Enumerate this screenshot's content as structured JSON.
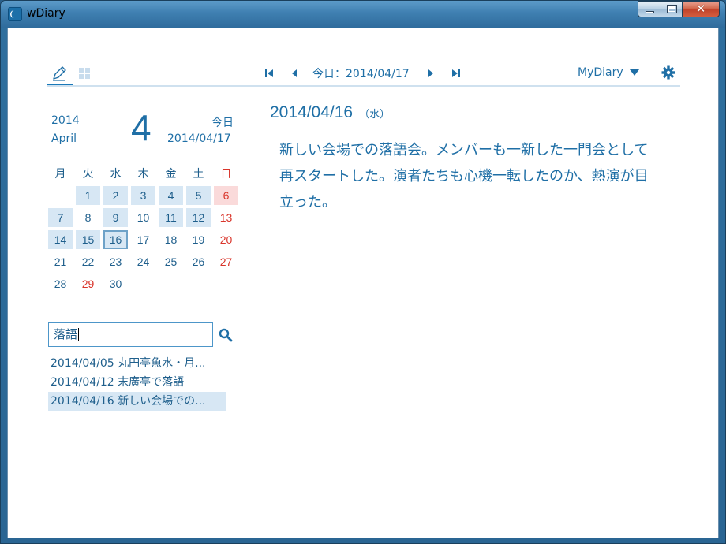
{
  "window": {
    "title": "wDiary",
    "close_symbol": "✕"
  },
  "toolbar": {
    "today_label": "今日：2014/04/17",
    "diary_name": "MyDiary"
  },
  "calendar": {
    "year": "2014",
    "month_name": "April",
    "month_number": "4",
    "today_label": "今日",
    "today_date": "2014/04/17",
    "weekdays": [
      "月",
      "火",
      "水",
      "木",
      "金",
      "土",
      "日"
    ],
    "weeks": [
      [
        {
          "d": ""
        },
        {
          "d": "1",
          "has": true
        },
        {
          "d": "2",
          "has": true
        },
        {
          "d": "3",
          "has": true
        },
        {
          "d": "4",
          "has": true
        },
        {
          "d": "5",
          "has": true
        },
        {
          "d": "6",
          "has": true
        }
      ],
      [
        {
          "d": "7",
          "has": true
        },
        {
          "d": "8"
        },
        {
          "d": "9",
          "has": true
        },
        {
          "d": "10"
        },
        {
          "d": "11",
          "has": true
        },
        {
          "d": "12",
          "has": true
        },
        {
          "d": "13"
        }
      ],
      [
        {
          "d": "14",
          "has": true
        },
        {
          "d": "15",
          "has": true
        },
        {
          "d": "16",
          "has": true,
          "selected": true
        },
        {
          "d": "17"
        },
        {
          "d": "18"
        },
        {
          "d": "19"
        },
        {
          "d": "20"
        }
      ],
      [
        {
          "d": "21"
        },
        {
          "d": "22"
        },
        {
          "d": "23"
        },
        {
          "d": "24"
        },
        {
          "d": "25"
        },
        {
          "d": "26"
        },
        {
          "d": "27"
        }
      ],
      [
        {
          "d": "28"
        },
        {
          "d": "29",
          "holiday": true
        },
        {
          "d": "30"
        },
        {
          "d": ""
        },
        {
          "d": ""
        },
        {
          "d": ""
        },
        {
          "d": ""
        }
      ]
    ]
  },
  "search": {
    "value": "落語",
    "results": [
      {
        "label": "2014/04/05 丸円亭魚水・月..."
      },
      {
        "label": "2014/04/12 末廣亭で落語"
      },
      {
        "label": "2014/04/16 新しい会場での...",
        "active": true
      }
    ]
  },
  "entry": {
    "date": "2014/04/16",
    "weekday": "（水）",
    "body": "新しい会場での落語会。メンバーも一新した一門会として再スタートした。演者たちも心機一転したのか、熱演が目立った。"
  },
  "colors": {
    "accent": "#1f6fa6",
    "highlight": "#d7e7f4",
    "sunday": "#d9352b"
  }
}
